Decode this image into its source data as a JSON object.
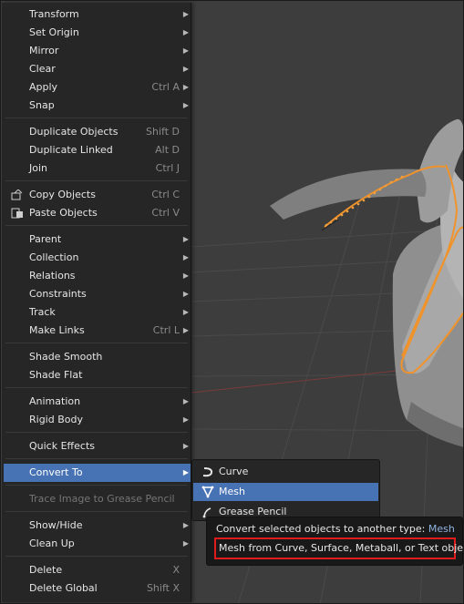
{
  "menu": {
    "items": [
      {
        "label": "Transform",
        "shortcut": "",
        "submenu": true
      },
      {
        "label": "Set Origin",
        "shortcut": "",
        "submenu": true
      },
      {
        "label": "Mirror",
        "shortcut": "",
        "submenu": true
      },
      {
        "label": "Clear",
        "shortcut": "",
        "submenu": true
      },
      {
        "label": "Apply",
        "shortcut": "Ctrl A",
        "submenu": true
      },
      {
        "label": "Snap",
        "shortcut": "",
        "submenu": true
      },
      {
        "label": "Duplicate Objects",
        "shortcut": "Shift D"
      },
      {
        "label": "Duplicate Linked",
        "shortcut": "Alt D"
      },
      {
        "label": "Join",
        "shortcut": "Ctrl J"
      },
      {
        "label": "Copy Objects",
        "shortcut": "Ctrl C",
        "icon": "copy-icon"
      },
      {
        "label": "Paste Objects",
        "shortcut": "Ctrl V",
        "icon": "paste-icon"
      },
      {
        "label": "Parent",
        "shortcut": "",
        "submenu": true
      },
      {
        "label": "Collection",
        "shortcut": "",
        "submenu": true
      },
      {
        "label": "Relations",
        "shortcut": "",
        "submenu": true
      },
      {
        "label": "Constraints",
        "shortcut": "",
        "submenu": true
      },
      {
        "label": "Track",
        "shortcut": "",
        "submenu": true
      },
      {
        "label": "Make Links",
        "shortcut": "Ctrl L",
        "submenu": true
      },
      {
        "label": "Shade Smooth",
        "shortcut": ""
      },
      {
        "label": "Shade Flat",
        "shortcut": ""
      },
      {
        "label": "Animation",
        "shortcut": "",
        "submenu": true
      },
      {
        "label": "Rigid Body",
        "shortcut": "",
        "submenu": true
      },
      {
        "label": "Quick Effects",
        "shortcut": "",
        "submenu": true
      },
      {
        "label": "Convert To",
        "shortcut": "",
        "submenu": true,
        "active": true
      },
      {
        "label": "Trace Image to Grease Pencil",
        "shortcut": "",
        "disabled": true
      },
      {
        "label": "Show/Hide",
        "shortcut": "",
        "submenu": true
      },
      {
        "label": "Clean Up",
        "shortcut": "",
        "submenu": true
      },
      {
        "label": "Delete",
        "shortcut": "X"
      },
      {
        "label": "Delete Global",
        "shortcut": "Shift X"
      }
    ]
  },
  "convert_submenu": {
    "items": [
      {
        "label": "Curve",
        "icon": "curve-icon"
      },
      {
        "label": "Mesh",
        "icon": "mesh-icon",
        "active": true
      },
      {
        "label": "Grease Pencil",
        "icon": "grease-pencil-icon"
      }
    ]
  },
  "tooltip": {
    "line1": "Convert selected objects to another type:",
    "operator": "Mesh",
    "line2": "Mesh from Curve, Surface, Metaball, or Text objects"
  },
  "colors": {
    "menu_bg": "#262626",
    "active_highlight": "#4772b3",
    "selection_outline": "#f0932b",
    "tooltip_highlight_border": "#e01b1b",
    "viewport_bg": "#3c3c3c"
  }
}
